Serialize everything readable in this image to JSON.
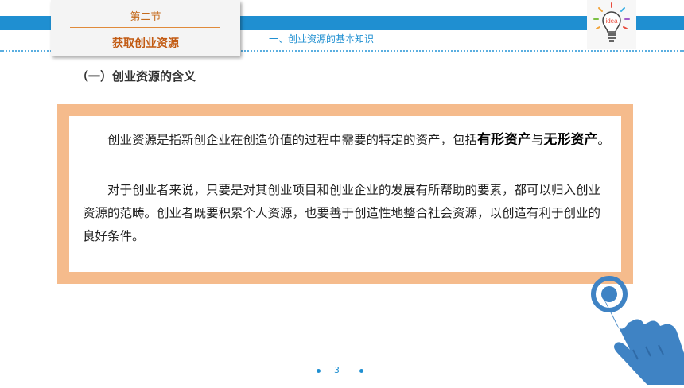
{
  "header": {
    "section_number": "第二节",
    "section_title": "获取创业资源",
    "subtopic": "一、创业资源的基本知识",
    "bulb_text": "idea"
  },
  "heading": "（一）创业资源的含义",
  "content": {
    "p1_prefix": "创业资源是指新创企业在创造价值的过程中需要的特定的资产，包括",
    "p1_bold1": "有形资产",
    "p1_mid": "与",
    "p1_bold2": "无形资产",
    "p1_end": "。",
    "p2": "对于创业者来说，只要是对其创业项目和创业企业的发展有所帮助的要素，都可以归入创业资源的范畴。创业者既要积累个人资源，也要善于创造性地整合社会资源，以创造有利于创业的良好条件。"
  },
  "footer": {
    "page_number": "3"
  },
  "colors": {
    "blue": "#1f8fd1",
    "frame": "#f5bb8c",
    "title": "#c25a12"
  },
  "icons": [
    "lightbulb-idea-icon",
    "pointing-hand-icon"
  ]
}
